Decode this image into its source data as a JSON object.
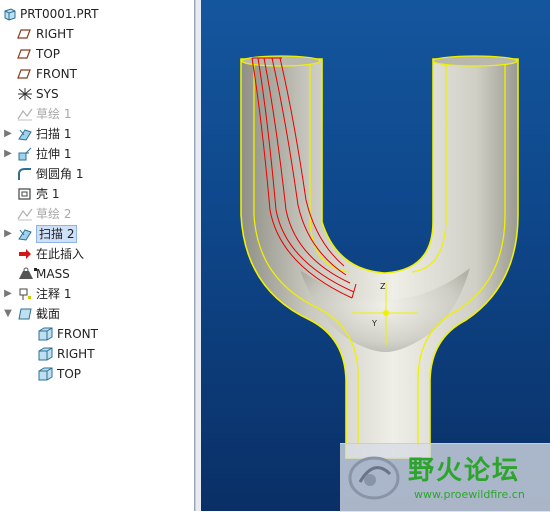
{
  "tree": {
    "root": "PRT0001.PRT",
    "items": [
      {
        "label": "RIGHT",
        "icon": "datum-plane-icon",
        "expand": "",
        "dim": false,
        "sel": false,
        "indent": 0
      },
      {
        "label": "TOP",
        "icon": "datum-plane-icon",
        "expand": "",
        "dim": false,
        "sel": false,
        "indent": 0
      },
      {
        "label": "FRONT",
        "icon": "datum-plane-icon",
        "expand": "",
        "dim": false,
        "sel": false,
        "indent": 0
      },
      {
        "label": "SYS",
        "icon": "coordinate-system-icon",
        "expand": "",
        "dim": false,
        "sel": false,
        "indent": 0
      },
      {
        "label": "草绘 1",
        "icon": "sketch-icon",
        "expand": "",
        "dim": true,
        "sel": false,
        "indent": 0
      },
      {
        "label": "扫描 1",
        "icon": "sweep-icon",
        "expand": "▶",
        "dim": false,
        "sel": false,
        "indent": 0
      },
      {
        "label": "拉伸 1",
        "icon": "extrude-icon",
        "expand": "▶",
        "dim": false,
        "sel": false,
        "indent": 0
      },
      {
        "label": "倒圆角 1",
        "icon": "round-icon",
        "expand": "",
        "dim": false,
        "sel": false,
        "indent": 0
      },
      {
        "label": "壳 1",
        "icon": "shell-icon",
        "expand": "",
        "dim": false,
        "sel": false,
        "indent": 0
      },
      {
        "label": "草绘 2",
        "icon": "sketch-icon",
        "expand": "",
        "dim": true,
        "sel": false,
        "indent": 0
      },
      {
        "label": "扫描 2",
        "icon": "sweep-icon",
        "expand": "▶",
        "dim": false,
        "sel": true,
        "indent": 0
      },
      {
        "label": "在此插入",
        "icon": "insert-here-arrow-icon",
        "expand": "",
        "dim": false,
        "sel": false,
        "indent": 0
      },
      {
        "label": "MASS",
        "icon": "mass-properties-icon",
        "expand": "",
        "dim": false,
        "sel": false,
        "indent": 0
      },
      {
        "label": "注释 1",
        "icon": "annotation-icon",
        "expand": "▶",
        "dim": false,
        "sel": false,
        "indent": 0
      },
      {
        "label": "截面",
        "icon": "section-icon",
        "expand": "▼",
        "dim": false,
        "sel": false,
        "indent": 0
      },
      {
        "label": "FRONT",
        "icon": "section-plane-icon",
        "expand": "",
        "dim": false,
        "sel": false,
        "indent": 1
      },
      {
        "label": "RIGHT",
        "icon": "section-plane-icon",
        "expand": "",
        "dim": false,
        "sel": false,
        "indent": 1
      },
      {
        "label": "TOP",
        "icon": "section-plane-icon",
        "expand": "",
        "dim": false,
        "sel": false,
        "indent": 1
      }
    ]
  },
  "viewport": {
    "axis_labels": {
      "z": "Z",
      "y": "Y"
    },
    "colors": {
      "background": "#0e4689",
      "body": "#dcdcd4",
      "edge": "#f0f000",
      "sketch": "#e60000"
    }
  },
  "watermark": {
    "title": "野火论坛",
    "url": "www.proewildfire.cn"
  }
}
